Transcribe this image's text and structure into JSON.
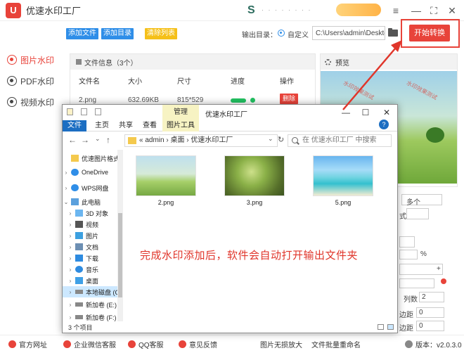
{
  "app": {
    "title": "优速水印工厂",
    "logo_char": "U",
    "brand_letter": "S",
    "promo_label": ""
  },
  "window_controls": {
    "menu": "≡",
    "minimize": "—",
    "maximize": "⛶",
    "close": "✕"
  },
  "sidebar": {
    "items": [
      {
        "label": "图片水印",
        "active": true
      },
      {
        "label": "PDF水印",
        "active": false
      },
      {
        "label": "视频水印",
        "active": false
      }
    ]
  },
  "toolbar": {
    "add_file": "添加文件",
    "add_dir": "添加目录",
    "clear_list": "清除列表",
    "output_label": "输出目录：",
    "output_mode": "自定义",
    "output_path": "C:\\Users\\admin\\Deskto",
    "start_label": "开始转换"
  },
  "file_table": {
    "header": "文件信息（3个）",
    "columns": [
      "文件名",
      "大小",
      "尺寸",
      "进度",
      "操作"
    ],
    "rows": [
      {
        "name": "2.png",
        "size": "632.69KB",
        "dim": "815*529",
        "progress": 1.0,
        "action": "删除"
      }
    ]
  },
  "preview": {
    "title": "预览",
    "watermark": "水印效果测试"
  },
  "settings_fragments": {
    "dropdown_value": "多个",
    "cols_label": "列数",
    "cols_value": "2",
    "margin_label_1": "边距",
    "margin_value_1": "0",
    "margin_label_2": "边距",
    "margin_value_2": "0",
    "percent": "%",
    "fragment_char": "式",
    "plus": "+"
  },
  "bottom_bar": {
    "items": [
      "官方网址",
      "企业微信客服",
      "QQ客服",
      "意见反馈",
      "图片无损放大",
      "文件批量重命名"
    ],
    "version": "版本：v2.0.3.0"
  },
  "explorer": {
    "manage_tab": "管理",
    "window_title": "优速水印工厂",
    "ribbon_tabs": [
      "文件",
      "主页",
      "共享",
      "查看",
      "图片工具"
    ],
    "address_path": [
      "«",
      "admin",
      "›",
      "桌面",
      "›",
      "优速水印工厂"
    ],
    "search_placeholder": "在 优速水印工厂 中搜索",
    "tree": [
      {
        "label": "优速图片格式",
        "icon": "folder",
        "chev": ""
      },
      {
        "label": "OneDrive",
        "icon": "cloud",
        "chev": "›"
      },
      {
        "label": "WPS网盘",
        "icon": "cloud",
        "chev": "›"
      },
      {
        "label": "此电脑",
        "icon": "pc",
        "chev": "⌄"
      },
      {
        "label": "3D 对象",
        "icon": "cube",
        "chev": "›"
      },
      {
        "label": "视频",
        "icon": "vid",
        "chev": "›"
      },
      {
        "label": "图片",
        "icon": "pic",
        "chev": "›"
      },
      {
        "label": "文档",
        "icon": "doc",
        "chev": "›"
      },
      {
        "label": "下载",
        "icon": "dl",
        "chev": "›"
      },
      {
        "label": "音乐",
        "icon": "music",
        "chev": "›"
      },
      {
        "label": "桌面",
        "icon": "desk",
        "chev": "›"
      },
      {
        "label": "本地磁盘 (C",
        "icon": "drive",
        "chev": "›",
        "selected": true
      },
      {
        "label": "新加卷 (E:)",
        "icon": "drive",
        "chev": "›"
      },
      {
        "label": "新加卷 (F:)",
        "icon": "drive",
        "chev": "›"
      }
    ],
    "files": [
      "2.png",
      "3.png",
      "5.png"
    ],
    "message": "完成水印添加后，软件会自动打开输出文件夹",
    "status": "3 个项目"
  }
}
